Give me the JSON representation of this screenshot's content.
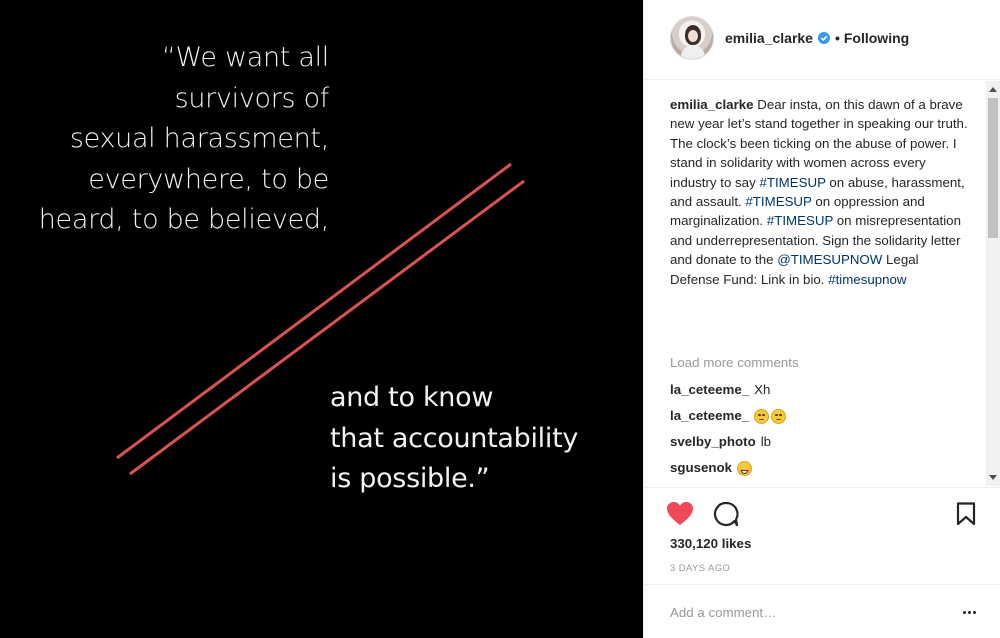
{
  "image": {
    "quote_top_lines": [
      "“We want all",
      "survivors of",
      "sexual harassment,",
      "everywhere, to be",
      "heard, to be believed,"
    ],
    "quote_bottom_lines": [
      "and to know",
      "that accountability",
      "is possible.”"
    ],
    "slash_color": "#d9534f"
  },
  "header": {
    "username": "emilia_clarke",
    "separator": "•",
    "follow_status": "Following",
    "verified_icon": "verified-badge-icon"
  },
  "caption": {
    "username": "emilia_clarke",
    "segments": [
      {
        "text": " Dear insta, on this dawn of a brave new year let’s stand together in speaking our truth.",
        "tag": false
      },
      {
        "text": "The clock’s been ticking on the abuse of power. I stand in solidarity with women across every industry to say ",
        "tag": false,
        "newline": true
      },
      {
        "text": "#TIMESUP",
        "tag": true
      },
      {
        "text": " on abuse, harassment, and assault. ",
        "tag": false
      },
      {
        "text": "#TIMESUP",
        "tag": true
      },
      {
        "text": " on oppression and marginalization. ",
        "tag": false
      },
      {
        "text": "#TIMESUP",
        "tag": true
      },
      {
        "text": " on misrepresentation and underrepresentation. Sign the solidarity letter and donate to the ",
        "tag": false
      },
      {
        "text": "@TIMESUPNOW",
        "tag": true
      },
      {
        "text": " Legal Defense Fund: Link in bio. ",
        "tag": false
      },
      {
        "text": "#timesupnow",
        "tag": true
      }
    ]
  },
  "load_more": "Load more comments",
  "comments": [
    {
      "user": "la_ceteeme_",
      "text": "Xh",
      "emojis": []
    },
    {
      "user": "la_ceteeme_",
      "text": "",
      "emojis": [
        "sad",
        "sad"
      ]
    },
    {
      "user": "svelby_photo",
      "text": "lb",
      "emojis": []
    },
    {
      "user": "sgusenok",
      "text": "",
      "emojis": [
        "heart-eyes"
      ]
    }
  ],
  "actions": {
    "like_icon": "heart-icon",
    "comment_icon": "comment-icon",
    "save_icon": "bookmark-icon",
    "like_color": "#ed4956"
  },
  "likes": "330,120 likes",
  "date": "3 DAYS AGO",
  "add_comment_placeholder": "Add a comment…",
  "colors": {
    "tag": "#003569",
    "muted": "#999999",
    "verified": "#3897f0"
  }
}
